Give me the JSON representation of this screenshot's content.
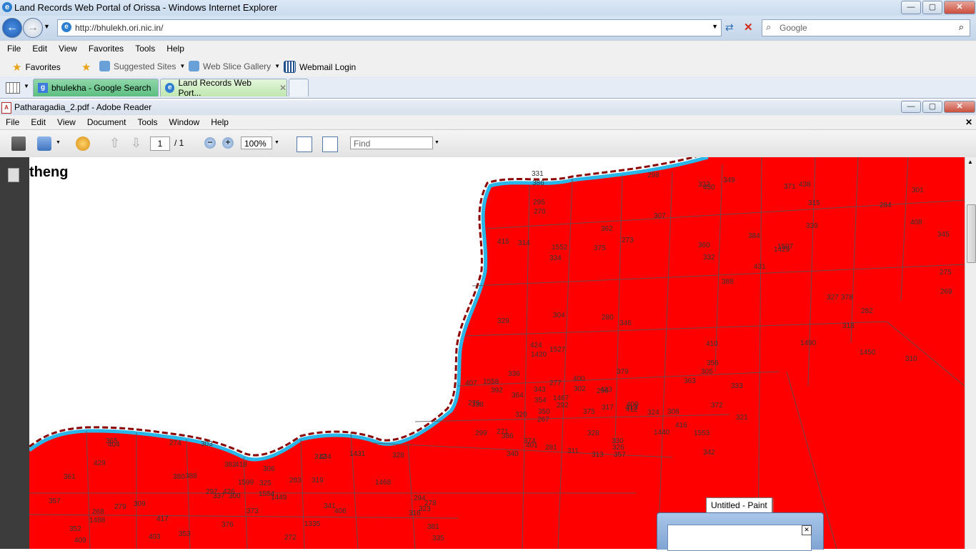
{
  "browser": {
    "title": "Land Records Web Portal of Orissa - Windows Internet Explorer",
    "address": "http://bhulekh.ori.nic.in/",
    "search_placeholder": "Google",
    "menu": [
      "File",
      "Edit",
      "View",
      "Favorites",
      "Tools",
      "Help"
    ],
    "favorites_label": "Favorites",
    "favorites_items": [
      "Suggested Sites",
      "Web Slice Gallery",
      "Webmail Login"
    ],
    "tabs": [
      {
        "label": "bhulekha - Google Search",
        "active": false
      },
      {
        "label": "Land Records Web Port...",
        "active": true
      }
    ]
  },
  "reader": {
    "title": "Patharagadia_2.pdf - Adobe Reader",
    "menu": [
      "File",
      "Edit",
      "View",
      "Document",
      "Tools",
      "Window",
      "Help"
    ],
    "page_current": "1",
    "page_total": "/ 1",
    "zoom": "100%",
    "find_placeholder": "Find"
  },
  "map": {
    "heading": "theng",
    "fill_color": "#ff0000",
    "boundary_color": "#8b0000",
    "river_color": "#29b6e8",
    "labels": [
      "388",
      "392",
      "426",
      "424",
      "409",
      "417",
      "438",
      "433",
      "434",
      "431",
      "336",
      "335",
      "334",
      "333",
      "337",
      "339",
      "340",
      "382",
      "384",
      "386",
      "388",
      "1420",
      "401",
      "418",
      "1429",
      "416",
      "429",
      "430",
      "338",
      "341",
      "345",
      "375",
      "376",
      "332",
      "343",
      "1431",
      "346",
      "342",
      "381",
      "378",
      "379",
      "380",
      "375",
      "1440",
      "403",
      "415",
      "413",
      "409",
      "410",
      "412",
      "1488",
      "408",
      "407",
      "406",
      "1490",
      "374",
      "404",
      "331",
      "330",
      "328",
      "349",
      "350",
      "361",
      "362",
      "363",
      "365",
      "371",
      "400",
      "1599",
      "329",
      "328",
      "353",
      "327",
      "354",
      "352",
      "386",
      "364",
      "357",
      "360",
      "326",
      "325",
      "1527",
      "324",
      "323",
      "356",
      "372",
      "373",
      "1450",
      "357",
      "1335",
      "322",
      "321",
      "319",
      "318",
      "317",
      "316",
      "314",
      "313",
      "312",
      "315",
      "320",
      "274",
      "275",
      "276",
      "279",
      "280",
      "281",
      "283",
      "284",
      "292",
      "294",
      "295",
      "296",
      "297",
      "298",
      "299",
      "300",
      "301",
      "302",
      "303",
      "304",
      "305",
      "306",
      "307",
      "308",
      "309",
      "310",
      "311",
      "1468",
      "270",
      "271",
      "272",
      "273",
      "277",
      "278",
      "282",
      "267",
      "268",
      "269",
      "1467",
      "1449",
      "1552",
      "1553",
      "1554",
      "1507",
      "1558"
    ]
  },
  "taskbar_preview": {
    "tooltip": "Untitled - Paint"
  },
  "colors": {
    "accent": "#2b6bc3",
    "map_red": "#ff0000"
  }
}
